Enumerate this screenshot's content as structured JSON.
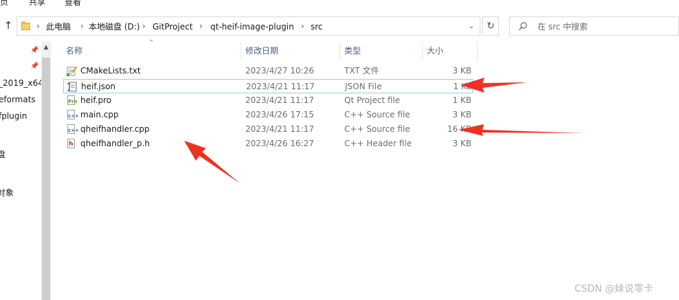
{
  "ribbon": {
    "items": [
      "页",
      "共享",
      "查看"
    ]
  },
  "address": {
    "crumbs": [
      "此电脑",
      "本地磁盘 (D:)",
      "GitProject",
      "qt-heif-image-plugin",
      "src"
    ],
    "search_placeholder": "在 src 中搜索"
  },
  "nav_pane": {
    "items": [
      "_2019_x64",
      "eformats",
      "fplugin",
      "盘",
      "对象"
    ]
  },
  "columns": {
    "name": "名称",
    "date": "修改日期",
    "type": "类型",
    "size": "大小"
  },
  "files": [
    {
      "name": "CMakeLists.txt",
      "date": "2023/4/27 10:26",
      "type": "TXT 文件",
      "size": "3 KB",
      "icon": "text-file-icon",
      "selected": false
    },
    {
      "name": "heif.json",
      "date": "2023/4/21 11:17",
      "type": "JSON File",
      "size": "1 KB",
      "icon": "json-file-icon",
      "selected": true
    },
    {
      "name": "heif.pro",
      "date": "2023/4/21 11:17",
      "type": "Qt Project file",
      "size": "1 KB",
      "icon": "qt-project-file-icon",
      "selected": false
    },
    {
      "name": "main.cpp",
      "date": "2023/4/26 17:15",
      "type": "C++ Source file",
      "size": "3 KB",
      "icon": "cpp-file-icon",
      "selected": false
    },
    {
      "name": "qheifhandler.cpp",
      "date": "2023/4/21 11:17",
      "type": "C++ Source file",
      "size": "16 KB",
      "icon": "cpp-file-icon",
      "selected": false
    },
    {
      "name": "qheifhandler_p.h",
      "date": "2023/4/26 16:27",
      "type": "C++ Header file",
      "size": "3 KB",
      "icon": "header-file-icon",
      "selected": false
    }
  ],
  "colors": {
    "arrow": "#f0311f",
    "selection_border": "#99c9ef",
    "header_text": "#4c607a"
  },
  "watermark": "CSDN @妹说零卡"
}
